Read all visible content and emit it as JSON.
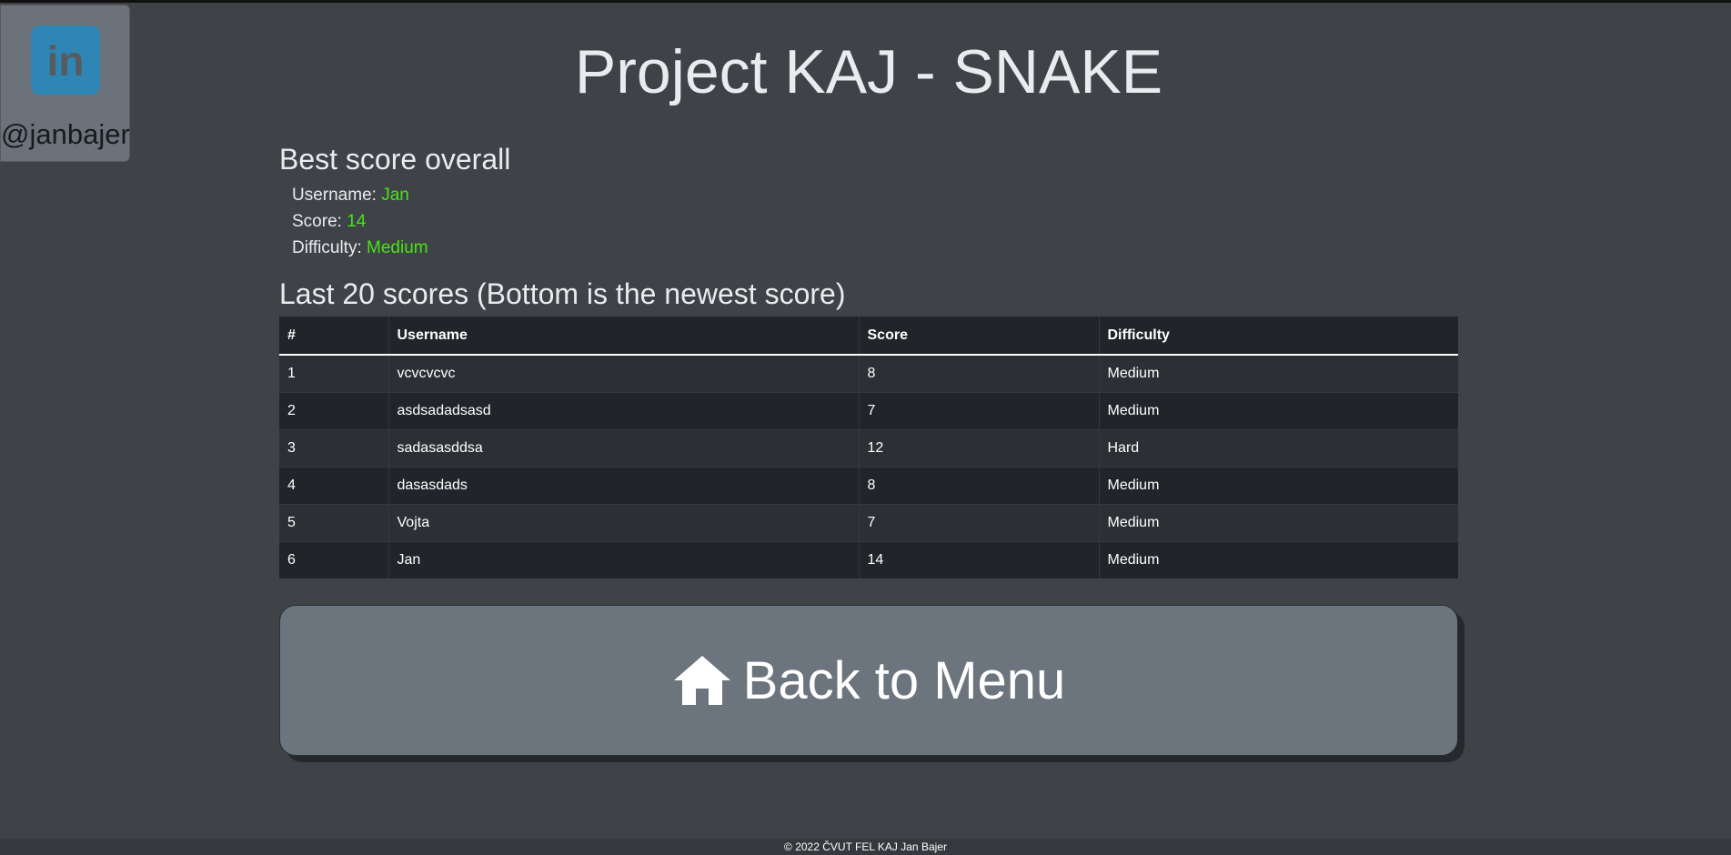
{
  "linkedin": {
    "handle": "@janbajer",
    "logo_text": "in",
    "icon": "linkedin-icon"
  },
  "title": "Project KAJ - SNAKE",
  "best": {
    "heading": "Best score overall",
    "username_label": "Username:",
    "username": "Jan",
    "score_label": "Score:",
    "score": "14",
    "difficulty_label": "Difficulty:",
    "difficulty": "Medium",
    "value_color": "#4ae21a"
  },
  "scores": {
    "heading": "Last 20 scores (Bottom is the newest score)",
    "columns": [
      "#",
      "Username",
      "Score",
      "Difficulty"
    ],
    "rows": [
      [
        "1",
        "vcvcvcvc",
        "8",
        "Medium"
      ],
      [
        "2",
        "asdsadadsasd",
        "7",
        "Medium"
      ],
      [
        "3",
        "sadasasddsa",
        "12",
        "Hard"
      ],
      [
        "4",
        "dasasdads",
        "8",
        "Medium"
      ],
      [
        "5",
        "Vojta",
        "7",
        "Medium"
      ],
      [
        "6",
        "Jan",
        "14",
        "Medium"
      ]
    ]
  },
  "back_button": {
    "label": "Back to Menu",
    "icon": "home-icon"
  },
  "footer": "© 2022 ČVUT FEL KAJ Jan Bajer"
}
